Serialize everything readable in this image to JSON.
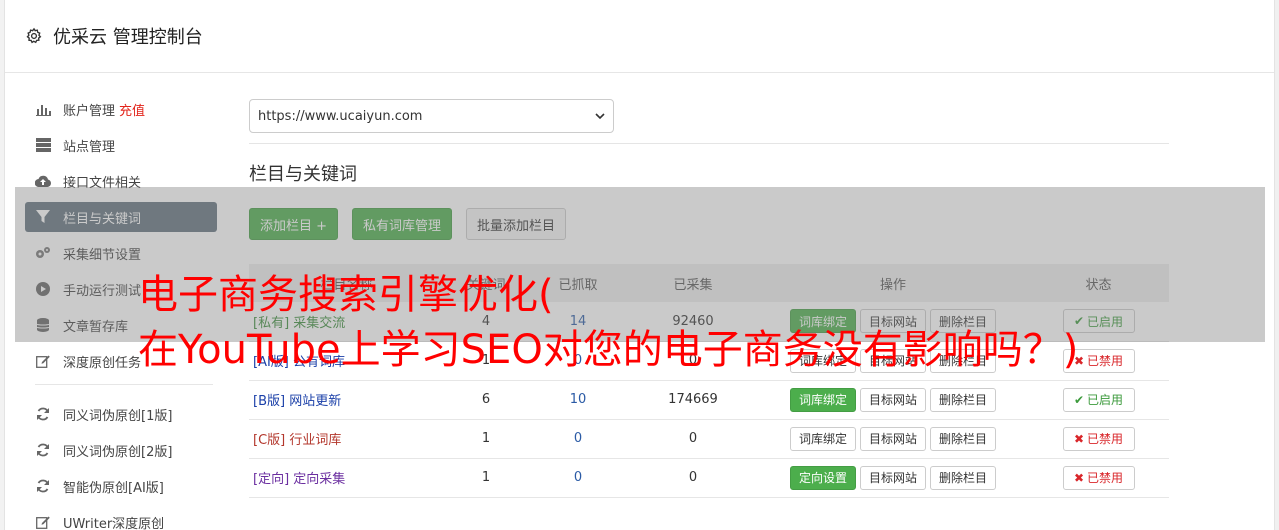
{
  "header": {
    "title": "优采云 管理控制台"
  },
  "sidebar": {
    "items": [
      {
        "label": "账户管理",
        "extra": "充值",
        "icon": "bar-chart-icon"
      },
      {
        "label": "站点管理",
        "icon": "server-icon"
      },
      {
        "label": "接口文件相关",
        "icon": "cloud-upload-icon"
      },
      {
        "label": "栏目与关键词",
        "icon": "filter-icon",
        "active": true
      },
      {
        "label": "采集细节设置",
        "icon": "gears-icon"
      },
      {
        "label": "手动运行测试",
        "icon": "play-icon"
      },
      {
        "label": "文章暂存库",
        "icon": "database-icon"
      },
      {
        "label": "深度原创任务",
        "icon": "edit-icon"
      }
    ],
    "items2": [
      {
        "label": "同义词伪原创[1版]",
        "icon": "refresh-icon"
      },
      {
        "label": "同义词伪原创[2版]",
        "icon": "refresh-icon"
      },
      {
        "label": "智能伪原创[AI版]",
        "icon": "refresh-icon"
      },
      {
        "label": "UWriter深度原创",
        "icon": "edit-icon"
      }
    ]
  },
  "main": {
    "site_select": "https://www.ucaiyun.com",
    "section_title": "栏目与关键词",
    "buttons": {
      "add_column": "添加栏目 +",
      "private_lib": "私有词库管理",
      "batch_add": "批量添加栏目"
    },
    "table": {
      "headers": [
        "栏目名称",
        "关键词",
        "已抓取",
        "已采集",
        "操作",
        "状态"
      ],
      "rows": [
        {
          "name": "[私有] 采集交流",
          "color": "green",
          "kw": "4",
          "grab": "14",
          "collected": "92460",
          "op1": "词库绑定",
          "op1_green": true,
          "op2": "目标网站",
          "op3": "删除栏目",
          "status": "已启用",
          "on": true
        },
        {
          "name": "[AI版] 公有词库",
          "color": "blue",
          "kw": "1",
          "grab": "0",
          "collected": "0",
          "op1": "词库绑定",
          "op1_green": false,
          "op2": "目标网站",
          "op3": "删除栏目",
          "status": "已禁用",
          "on": false
        },
        {
          "name": "[B版] 网站更新",
          "color": "blue",
          "kw": "6",
          "grab": "10",
          "collected": "174669",
          "op1": "词库绑定",
          "op1_green": true,
          "op2": "目标网站",
          "op3": "删除栏目",
          "status": "已启用",
          "on": true
        },
        {
          "name": "[C版] 行业词库",
          "color": "red",
          "kw": "1",
          "grab": "0",
          "collected": "0",
          "op1": "词库绑定",
          "op1_green": false,
          "op2": "目标网站",
          "op3": "删除栏目",
          "status": "已禁用",
          "on": false
        },
        {
          "name": "[定向] 定向采集",
          "color": "purple",
          "kw": "1",
          "grab": "0",
          "collected": "0",
          "op1": "定向设置",
          "op1_green": true,
          "op2": "目标网站",
          "op3": "删除栏目",
          "status": "已禁用",
          "on": false
        }
      ]
    }
  },
  "overlay": {
    "line1": "电子商务搜索引擎优化(",
    "line2": "在YouTube上学习SEO对您的电子商务没有影响吗？)"
  }
}
